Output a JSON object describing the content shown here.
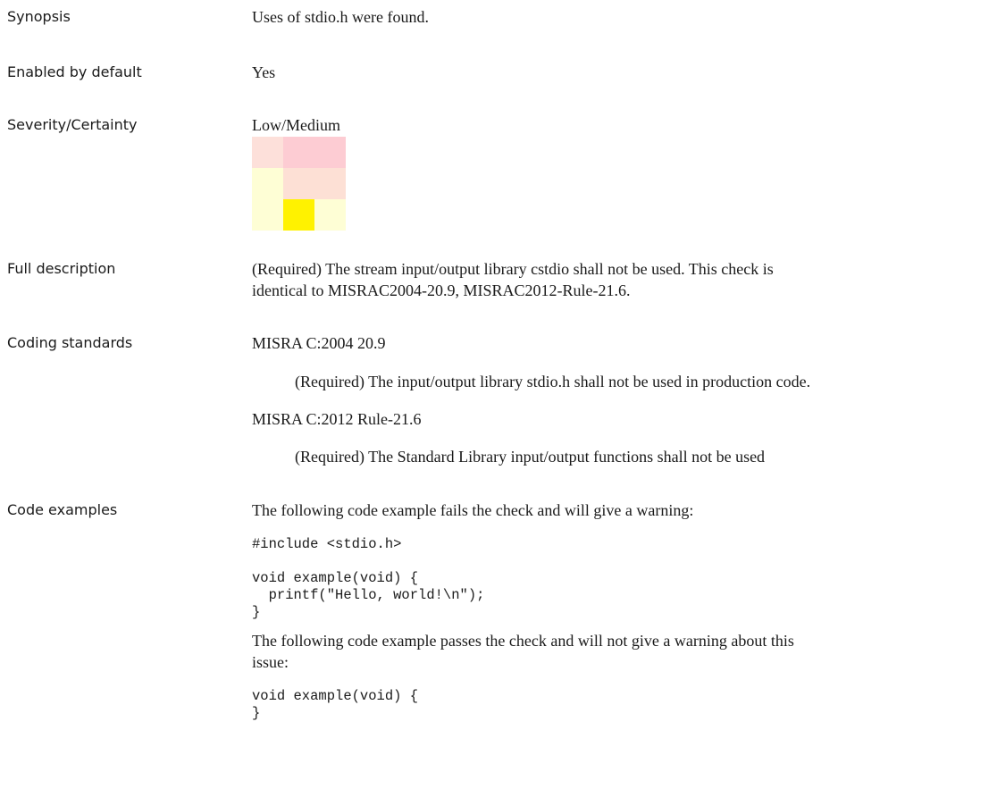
{
  "synopsis": {
    "label": "Synopsis",
    "text": "Uses of stdio.h were found."
  },
  "enabled": {
    "label": "Enabled by default",
    "text": "Yes"
  },
  "severity": {
    "label": "Severity/Certainty",
    "text": "Low/Medium",
    "matrix_colors": [
      [
        "#fde0da",
        "#fdccd3",
        "#fdccd3"
      ],
      [
        "#fefed5",
        "#fde0d5",
        "#fde0d5"
      ],
      [
        "#fefed5",
        "#fff200",
        "#fefed5"
      ]
    ]
  },
  "full_description": {
    "label": "Full description",
    "line1": "(Required) The stream input/output library cstdio shall not be used. This check is",
    "line2": "identical to MISRAC2004-20.9, MISRAC2012-Rule-21.6."
  },
  "coding_standards": {
    "label": "Coding standards",
    "std1_title": "MISRA C:2004 20.9",
    "std1_desc": "(Required) The input/output library stdio.h shall not be used in production code.",
    "std2_title": "MISRA C:2012 Rule-21.6",
    "std2_desc": "(Required) The Standard Library input/output functions shall not be used"
  },
  "code_examples": {
    "label": "Code examples",
    "fail_intro": "The following code example fails the check and will give a warning:",
    "fail_code": "#include <stdio.h>\n\nvoid example(void) {\n  printf(\"Hello, world!\\n\");\n}",
    "pass_intro_line1": "The following code example passes the check and will not give a warning about this",
    "pass_intro_line2": "issue:",
    "pass_code": "void example(void) {\n}"
  }
}
